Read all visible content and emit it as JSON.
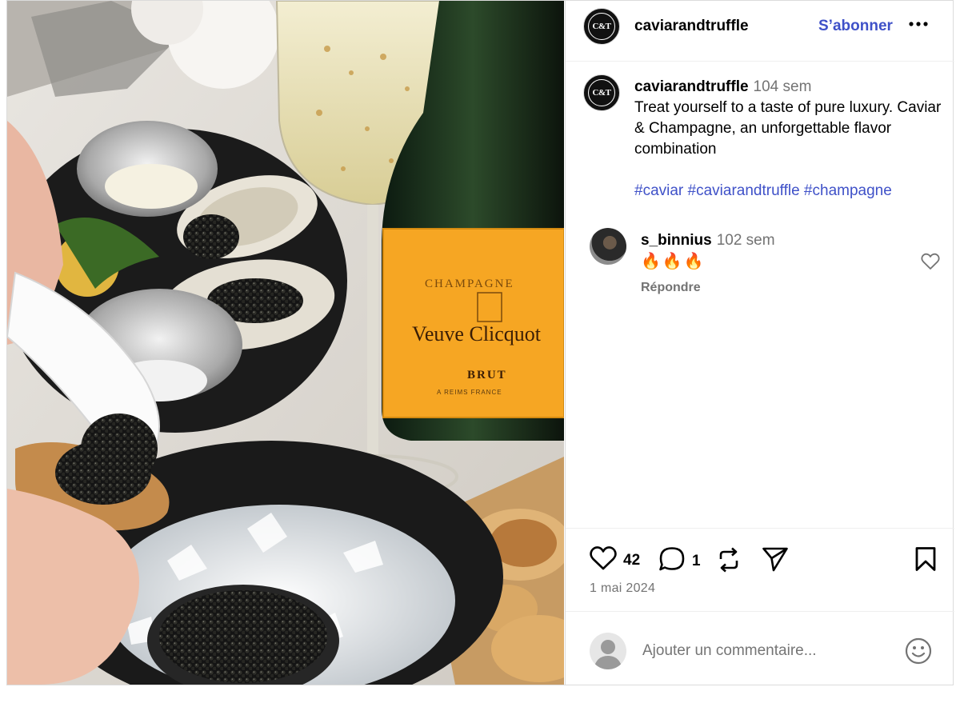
{
  "post": {
    "account": "caviarandtruffle",
    "logo_text": "C&T",
    "follow_label": "S’abonner",
    "more_label": "•••",
    "caption": {
      "username": "caviarandtruffle",
      "time": "104 sem",
      "text": "Treat yourself to a taste of pure luxury. Caviar & Champagne, an unforgettable flavor combination",
      "hashtags": "#caviar #caviarandtruffle #champagne"
    },
    "comments": [
      {
        "username": "s_binnius",
        "time": "102 sem",
        "text": "🔥🔥🔥",
        "reply_label": "Répondre"
      }
    ],
    "actions": {
      "like_count": "42",
      "comment_count": "1"
    },
    "date": "1 mai 2024",
    "add_comment": {
      "placeholder": "Ajouter un commentaire..."
    }
  },
  "photo": {
    "label_lines": [
      "CHAMPAGNE",
      "Veuve Clicquot",
      "BRUT",
      "A REIMS FRANCE"
    ]
  },
  "colors": {
    "accent": "#3f51c8",
    "muted": "#737373",
    "label_orange": "#f6a623"
  },
  "icons": [
    "heart-icon",
    "comment-icon",
    "repost-icon",
    "share-icon",
    "bookmark-icon",
    "smiley-icon",
    "more-icon"
  ]
}
